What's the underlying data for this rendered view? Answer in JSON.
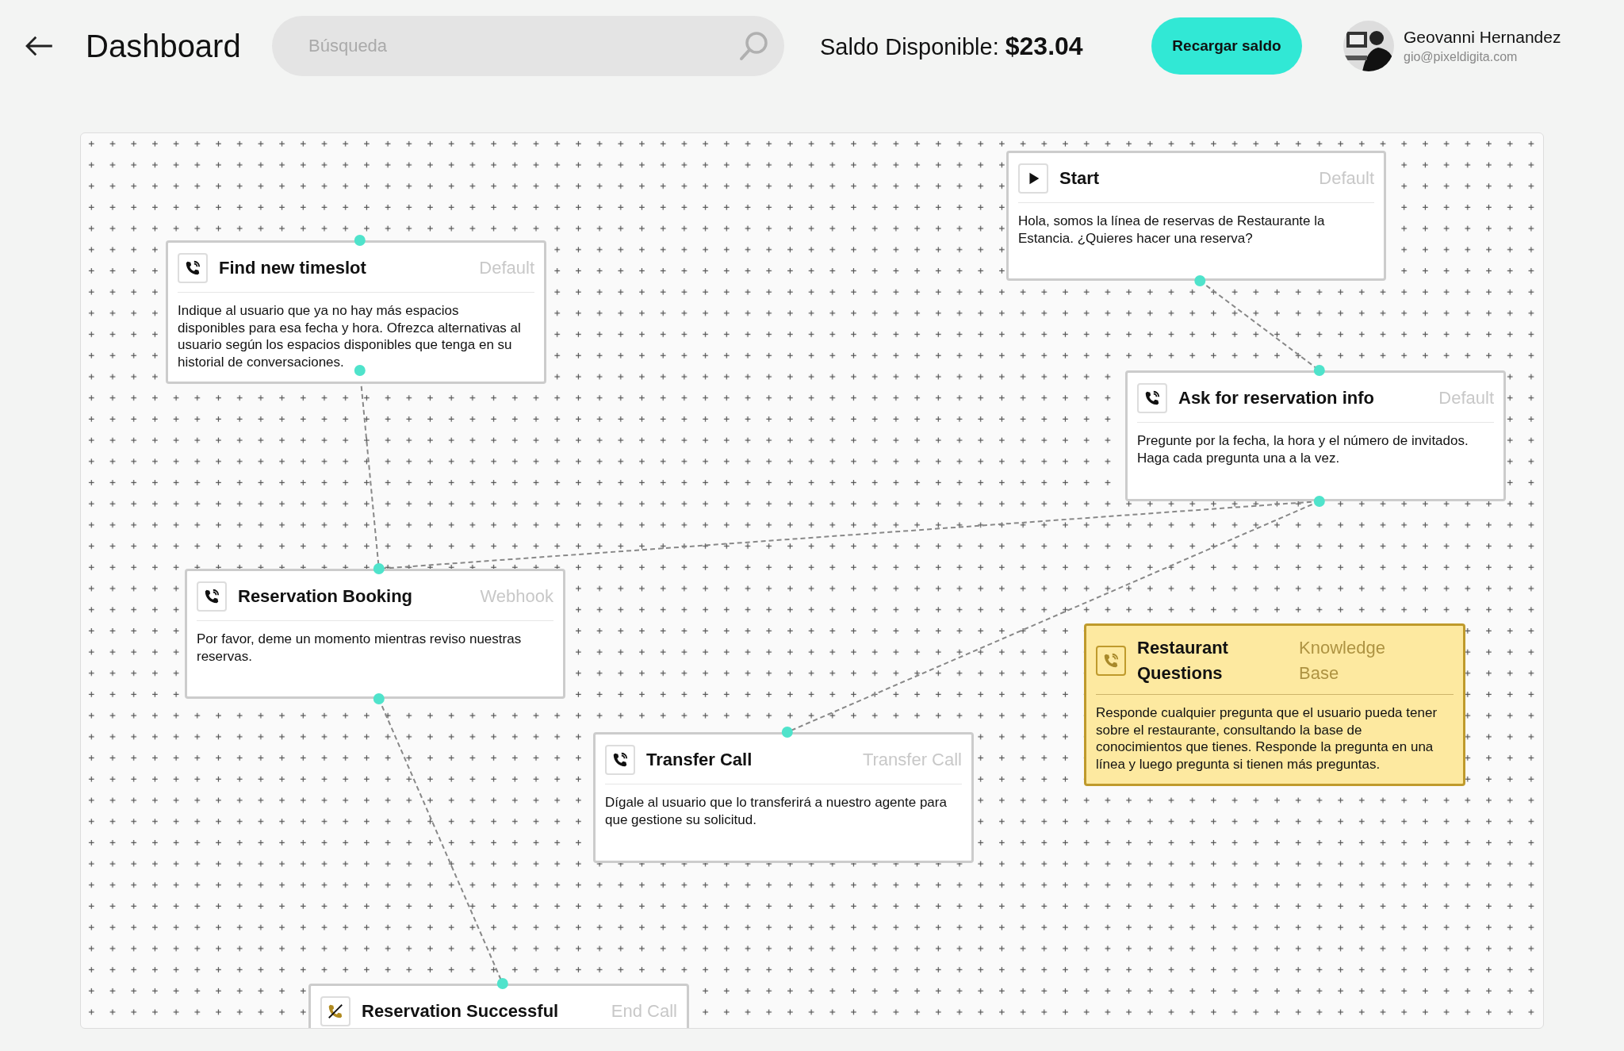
{
  "header": {
    "title": "Dashboard",
    "search": {
      "placeholder": "Búsqueda"
    },
    "balance": "Saldo Disponible: **$23.04**",
    "recharge_button": "Recargar saldo",
    "user": {
      "name": "Geovanni Hernandez",
      "email": "gio@pixeldigita.com"
    }
  },
  "nodes": [
    {
      "kind": "start",
      "title": "Start",
      "type": "Default",
      "text": "Hola, somos la línea de reservas de Restaurante la Estancia. ¿Quieres hacer una reserva?"
    },
    {
      "kind": "call",
      "title": "Find new timeslot",
      "type": "Default",
      "text": "Indique al usuario que ya no hay más espacios disponibles para esa fecha y hora. Ofrezca alternativas al usuario según los espacios disponibles que tenga en su historial de conversaciones."
    },
    {
      "kind": "call",
      "title": "Ask for reservation info",
      "type": "Default",
      "text": "Pregunte por la fecha, la hora y el número de invitados. Haga cada pregunta una a la vez."
    },
    {
      "kind": "call",
      "title": "Reservation Booking",
      "type": "Webhook",
      "text": "Por favor, deme un momento mientras reviso nuestras reservas."
    },
    {
      "kind": "knowledge",
      "title": "Restaurant Questions",
      "type": "Knowledge Base",
      "text": "Responde cualquier pregunta que el usuario pueda tener sobre el restaurante, consultando la base de conocimientos que tienes. Responde la pregunta en una línea y luego pregunta si tienen más preguntas."
    },
    {
      "kind": "call",
      "title": "Transfer Call",
      "type": "Transfer Call",
      "text": "Dígale al usuario que lo transferirá a nuestro agente para que gestione su solicitud."
    },
    {
      "kind": "end_call",
      "title": "Reservation Successful",
      "type": "End Call"
    }
  ]
}
